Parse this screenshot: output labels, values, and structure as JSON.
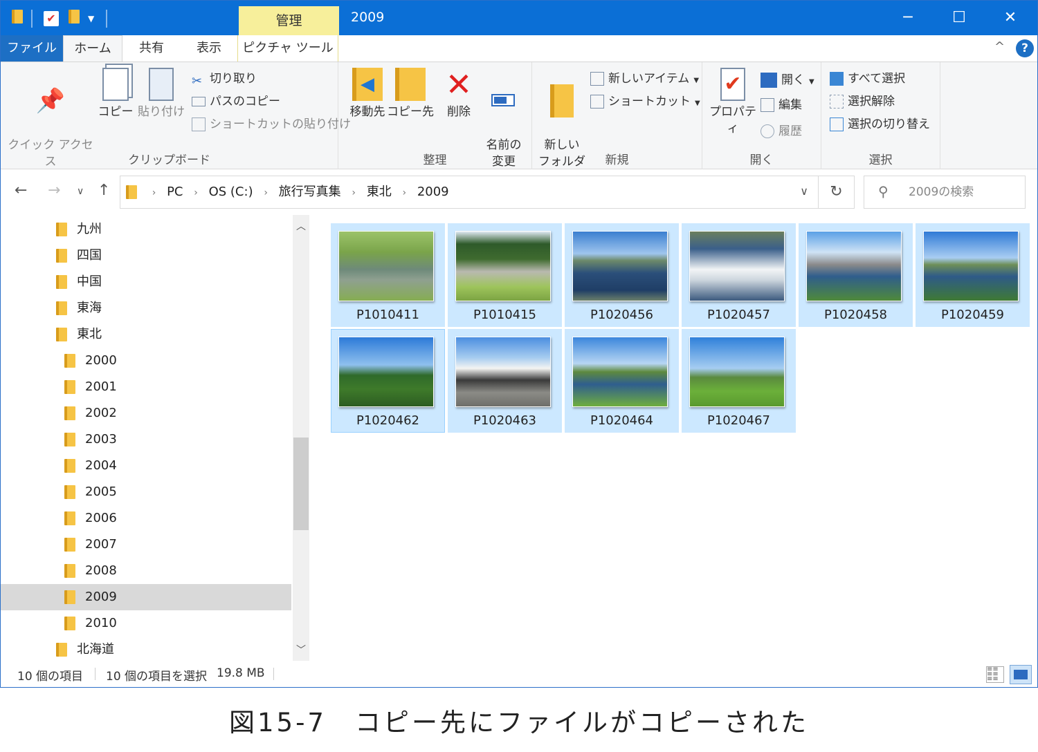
{
  "window": {
    "title": "2009",
    "context_tab": "管理"
  },
  "tabs": {
    "file": "ファイル",
    "home": "ホーム",
    "share": "共有",
    "view": "表示",
    "picture_tools": "ピクチャ ツール"
  },
  "ribbon": {
    "clipboard": {
      "label": "クリップボード",
      "pin": "クイック アクセス\nにピン留めする",
      "copy": "コピー",
      "paste": "貼り付け",
      "cut": "切り取り",
      "copy_path": "パスのコピー",
      "paste_shortcut": "ショートカットの貼り付け"
    },
    "organize": {
      "label": "整理",
      "move_to": "移動先",
      "copy_to": "コピー先",
      "delete": "削除",
      "rename": "名前の\n変更"
    },
    "new": {
      "label": "新規",
      "new_folder": "新しい\nフォルダー",
      "new_item": "新しいアイテム",
      "shortcut": "ショートカット"
    },
    "open": {
      "label": "開く",
      "properties": "プロパティ",
      "open": "開く",
      "edit": "編集",
      "history": "履歴"
    },
    "select": {
      "label": "選択",
      "select_all": "すべて選択",
      "select_none": "選択解除",
      "invert": "選択の切り替え"
    }
  },
  "address": {
    "crumbs": [
      "PC",
      "OS (C:)",
      "旅行写真集",
      "東北",
      "2009"
    ],
    "search_placeholder": "2009の検索"
  },
  "tree": [
    {
      "label": "九州",
      "level": 1
    },
    {
      "label": "四国",
      "level": 1
    },
    {
      "label": "中国",
      "level": 1
    },
    {
      "label": "東海",
      "level": 1
    },
    {
      "label": "東北",
      "level": 1
    },
    {
      "label": "2000",
      "level": 2
    },
    {
      "label": "2001",
      "level": 2
    },
    {
      "label": "2002",
      "level": 2
    },
    {
      "label": "2003",
      "level": 2
    },
    {
      "label": "2004",
      "level": 2
    },
    {
      "label": "2005",
      "level": 2
    },
    {
      "label": "2006",
      "level": 2
    },
    {
      "label": "2007",
      "level": 2
    },
    {
      "label": "2008",
      "level": 2
    },
    {
      "label": "2009",
      "level": 2,
      "selected": true
    },
    {
      "label": "2010",
      "level": 2
    },
    {
      "label": "北海道",
      "level": 1
    }
  ],
  "files": [
    {
      "name": "P1010411",
      "scene": "pond"
    },
    {
      "name": "P1010415",
      "scene": "canal"
    },
    {
      "name": "P1020456",
      "scene": "river"
    },
    {
      "name": "P1020457",
      "scene": "weir"
    },
    {
      "name": "P1020458",
      "scene": "bridge"
    },
    {
      "name": "P1020459",
      "scene": "river2"
    },
    {
      "name": "P1020462",
      "scene": "field"
    },
    {
      "name": "P1020463",
      "scene": "house"
    },
    {
      "name": "P1020464",
      "scene": "stream"
    },
    {
      "name": "P1020467",
      "scene": "meadow"
    }
  ],
  "status": {
    "count": "10 個の項目",
    "selected": "10 個の項目を選択",
    "size": "19.8 MB"
  },
  "caption": "図15-7　コピー先にファイルがコピーされた"
}
